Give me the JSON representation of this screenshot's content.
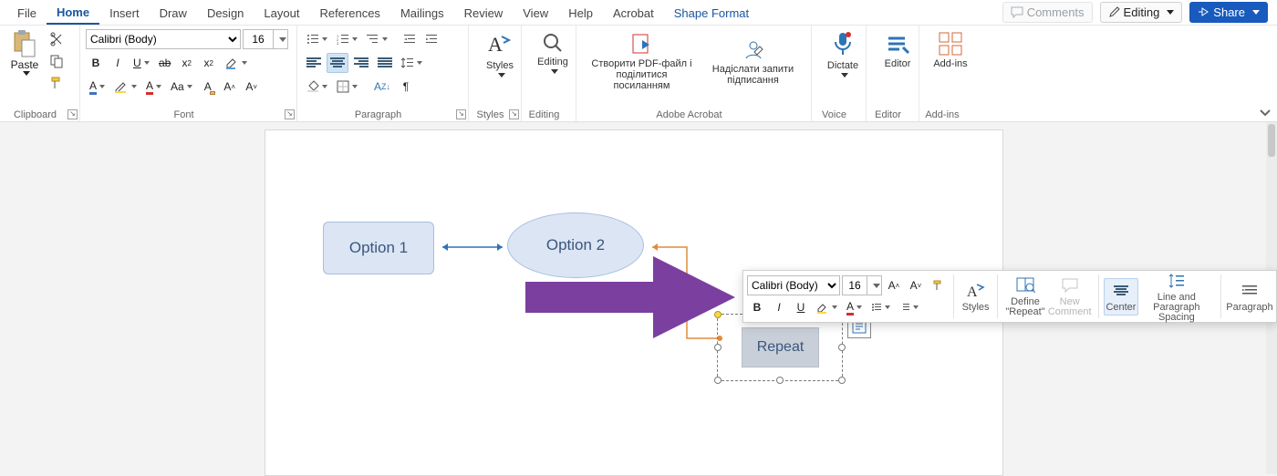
{
  "tabs": {
    "file": "File",
    "home": "Home",
    "insert": "Insert",
    "draw": "Draw",
    "design": "Design",
    "layout": "Layout",
    "references": "References",
    "mailings": "Mailings",
    "review": "Review",
    "view": "View",
    "help": "Help",
    "acrobat": "Acrobat",
    "shapeformat": "Shape Format"
  },
  "titlebar": {
    "comments": "Comments",
    "editing": "Editing",
    "share": "Share"
  },
  "font": {
    "name": "Calibri (Body)",
    "size": "16"
  },
  "groups": {
    "clipboard": "Clipboard",
    "font": "Font",
    "paragraph": "Paragraph",
    "styles": "Styles",
    "editing": "Editing",
    "acrobat": "Adobe Acrobat",
    "voice": "Voice",
    "editor": "Editor",
    "addins": "Add-ins"
  },
  "clipboard": {
    "paste": "Paste"
  },
  "styles": {
    "label": "Styles"
  },
  "editing": {
    "label": "Editing"
  },
  "acrobat": {
    "create": "Створити PDF-файл і поділитися посиланням",
    "sign": "Надіслати запити підписання"
  },
  "voice": {
    "dictate": "Dictate"
  },
  "editor": {
    "label": "Editor"
  },
  "addins": {
    "label": "Add-ins"
  },
  "shapes": {
    "option1": "Option 1",
    "option2": "Option 2",
    "repeat": "Repeat"
  },
  "mini": {
    "font": "Calibri (Body)",
    "size": "16",
    "styles": "Styles",
    "define": "Define \"Repeat\"",
    "new_comment": "New Comment",
    "center": "Center",
    "spacing": "Line and Paragraph Spacing",
    "paragraph": "Paragraph"
  },
  "colors": {
    "accent": "#185abd",
    "shapeFill": "#dbe5f4",
    "shapeStroke": "#a9bedf",
    "arrow": "#7b3fa0",
    "connector": "#e08b3c"
  }
}
